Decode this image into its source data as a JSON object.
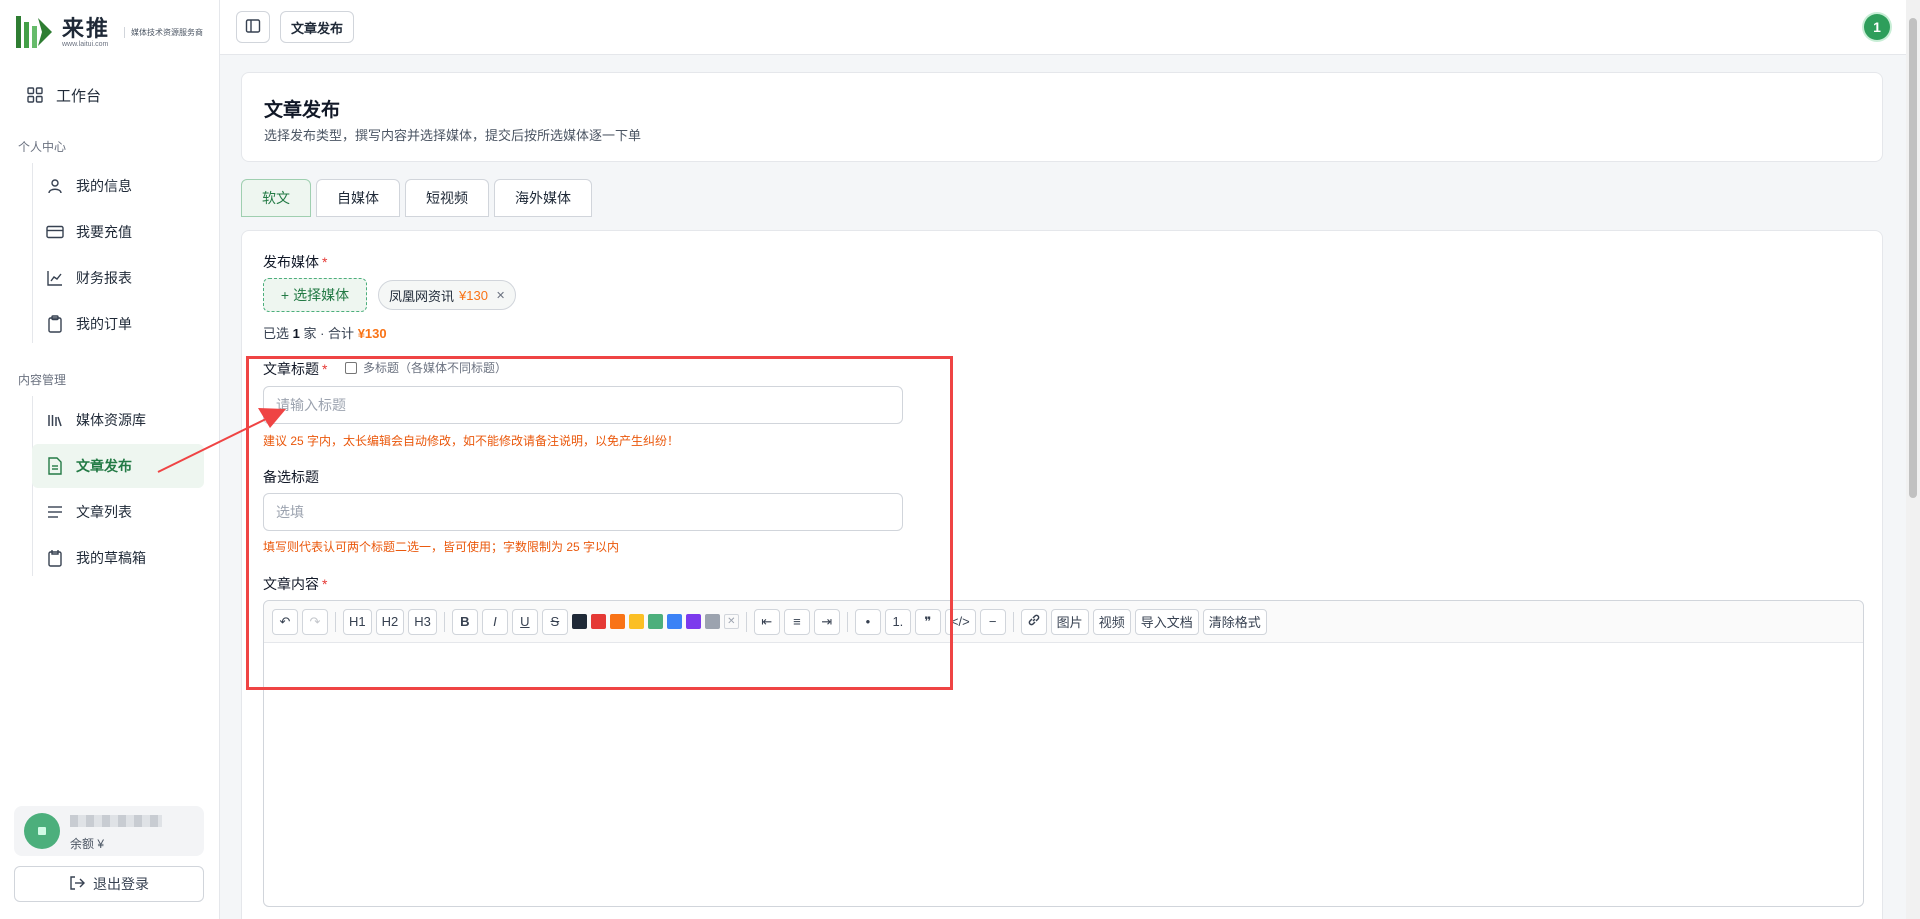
{
  "brand": {
    "name": "来推",
    "url": "www.laitui.com",
    "slogan": "媒体技术资源服务商",
    "color": "#2e7d32"
  },
  "sidebar": {
    "workbench": "工作台",
    "sections": [
      {
        "title": "个人中心",
        "items": [
          {
            "label": "我的信息",
            "icon": "user-icon"
          },
          {
            "label": "我要充值",
            "icon": "credit-card-icon"
          },
          {
            "label": "财务报表",
            "icon": "line-chart-icon"
          },
          {
            "label": "我的订单",
            "icon": "clipboard-icon"
          }
        ]
      },
      {
        "title": "内容管理",
        "items": [
          {
            "label": "媒体资源库",
            "icon": "library-icon"
          },
          {
            "label": "文章发布",
            "icon": "document-icon",
            "active": true
          },
          {
            "label": "文章列表",
            "icon": "list-icon"
          },
          {
            "label": "我的草稿箱",
            "icon": "draft-icon"
          }
        ]
      }
    ],
    "user": {
      "balance_label": "余额 ¥"
    },
    "logout": "退出登录"
  },
  "topbar": {
    "breadcrumb": "文章发布",
    "notification_count": "1"
  },
  "page": {
    "title": "文章发布",
    "description": "选择发布类型，撰写内容并选择媒体，提交后按所选媒体逐一下单"
  },
  "tabs": [
    {
      "label": "软文",
      "active": true
    },
    {
      "label": "自媒体"
    },
    {
      "label": "短视频"
    },
    {
      "label": "海外媒体"
    }
  ],
  "form": {
    "media_label": "发布媒体",
    "select_media_button": "选择媒体",
    "selected_media": [
      {
        "name": "凤凰网资讯",
        "price": "¥130"
      }
    ],
    "summary_prefix": "已选",
    "summary_count": "1",
    "summary_middle": "家 · 合计",
    "summary_total": "¥130",
    "title_label": "文章标题",
    "multi_title_label": "多标题（各媒体不同标题）",
    "title_placeholder": "请输入标题",
    "title_hint": "建议 25 字内，太长编辑会自动修改，如不能修改请备注说明，以免产生纠纷！",
    "alt_title_label": "备选标题",
    "alt_title_placeholder": "选填",
    "alt_title_hint": "填写则代表认可两个标题二选一，皆可使用；字数限制为 25 字以内",
    "content_label": "文章内容"
  },
  "editor": {
    "headings": [
      "H1",
      "H2",
      "H3"
    ],
    "format": [
      "B",
      "I",
      "U",
      "S"
    ],
    "colors": [
      "#1f2937",
      "#e53935",
      "#f97316",
      "#fbbf24",
      "#4caf7c",
      "#3b82f6",
      "#7c3aed",
      "#9ca3af"
    ],
    "image_button": "图片",
    "video_button": "视频",
    "import_button": "导入文档",
    "clear_button": "清除格式"
  }
}
